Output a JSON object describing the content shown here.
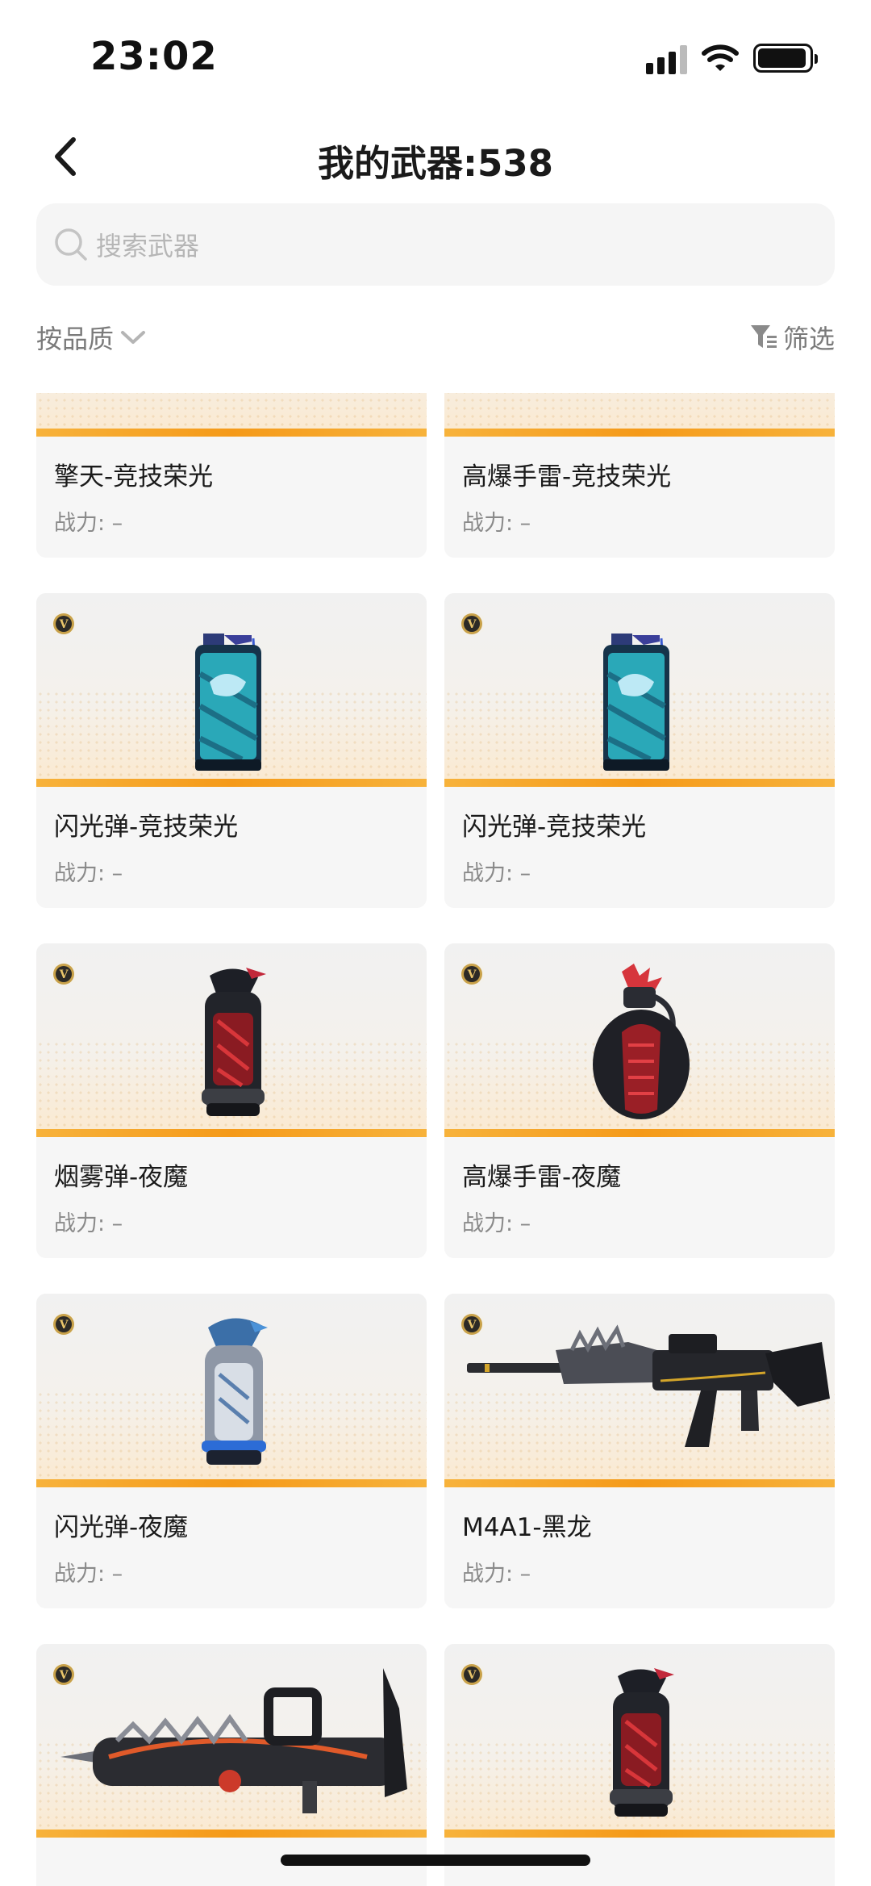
{
  "status_bar": {
    "time": "23:02",
    "battery_level": 0.95
  },
  "nav": {
    "title": "我的武器:538"
  },
  "search": {
    "placeholder": "搜索武器"
  },
  "filters": {
    "sort_label": "按品质",
    "filter_label": "筛选"
  },
  "colors": {
    "accent_orange": "#f59a19",
    "badge_gold": "#c9a24a",
    "card_bg": "#f6f6f6"
  },
  "weapons": [
    {
      "name": "擎天-竞技荣光",
      "power": "战力: –",
      "art": "blue-rifle",
      "badge": false
    },
    {
      "name": "高爆手雷-竞技荣光",
      "power": "战力: –",
      "art": "blue-grenade",
      "badge": false
    },
    {
      "name": "闪光弹-竞技荣光",
      "power": "战力: –",
      "art": "cyan-canister",
      "badge": true
    },
    {
      "name": "闪光弹-竞技荣光",
      "power": "战力: –",
      "art": "cyan-canister",
      "badge": true
    },
    {
      "name": "烟雾弹-夜魔",
      "power": "战力: –",
      "art": "dark-red-canister",
      "badge": true
    },
    {
      "name": "高爆手雷-夜魔",
      "power": "战力: –",
      "art": "dark-red-grenade",
      "badge": true
    },
    {
      "name": "闪光弹-夜魔",
      "power": "战力: –",
      "art": "silver-blue-canister",
      "badge": true
    },
    {
      "name": "M4A1-黑龙",
      "power": "战力: –",
      "art": "black-dragon-rifle",
      "badge": true
    },
    {
      "name": "",
      "power": "",
      "art": "dragon-gatling",
      "badge": true
    },
    {
      "name": "",
      "power": "",
      "art": "dark-red-canister",
      "badge": true
    }
  ]
}
